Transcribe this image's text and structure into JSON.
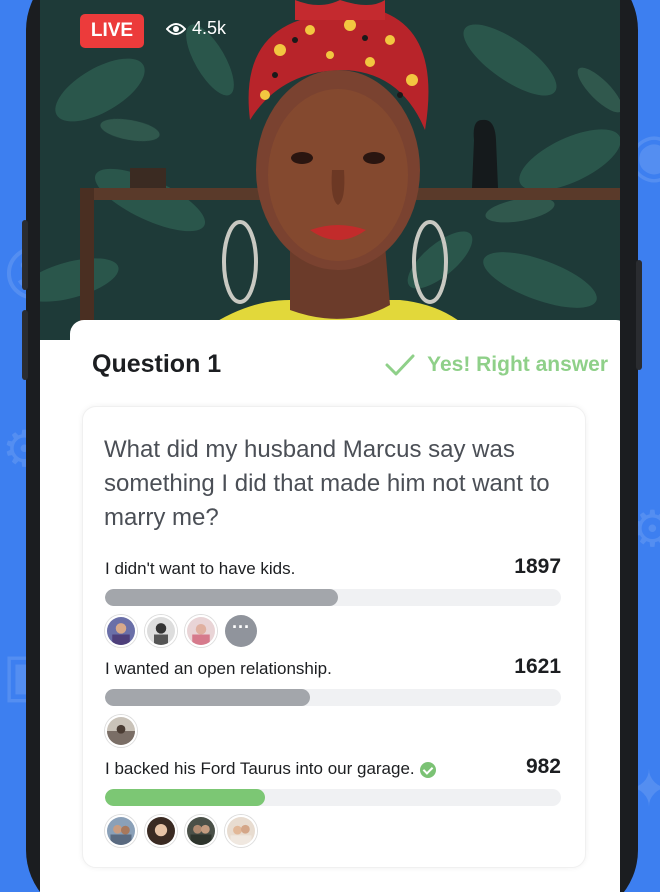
{
  "stream": {
    "live_label": "LIVE",
    "viewers": "4.5k"
  },
  "quiz": {
    "question_label": "Question 1",
    "result_text": "Yes! Right answer",
    "question_text": "What did my husband Marcus say was something I did that made him not want to marry me?",
    "options": [
      {
        "label": "I didn't want to have kids.",
        "count": "1897",
        "fill_fraction": 0.51,
        "correct": false
      },
      {
        "label": "I wanted an open relationship.",
        "count": "1621",
        "fill_fraction": 0.45,
        "correct": false
      },
      {
        "label": "I backed his Ford Taurus into our garage.",
        "count": "982",
        "fill_fraction": 0.35,
        "correct": true
      }
    ],
    "more_label": "···"
  },
  "colors": {
    "background": "#3d7ff0",
    "live_red": "#ec3b3b",
    "correct_green": "#7cc774",
    "result_green": "#8fd089",
    "bar_gray": "#a3a6ab"
  },
  "icons": [
    "eye-icon",
    "check-icon",
    "correct-check-icon",
    "more-icon"
  ]
}
